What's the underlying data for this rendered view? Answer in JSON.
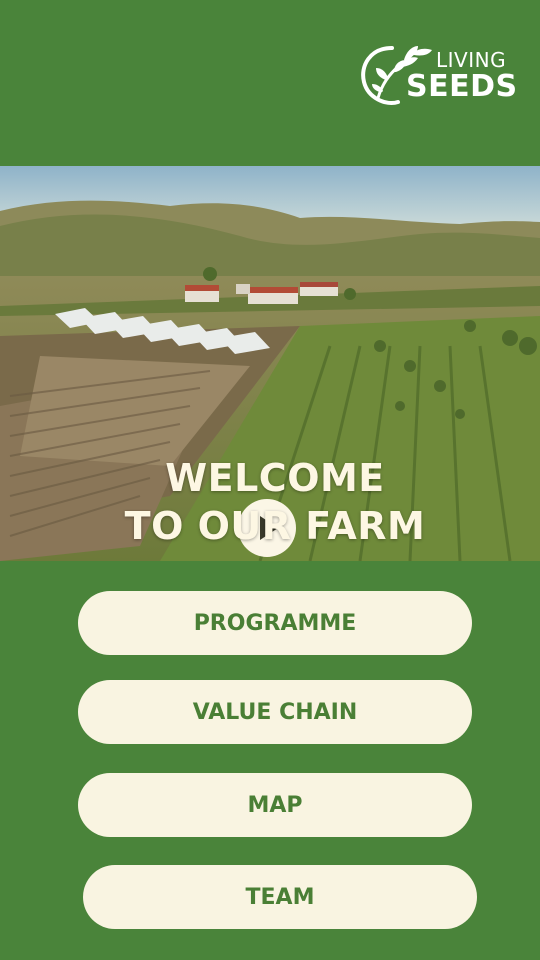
{
  "brand": {
    "line1": "LIVING",
    "line2": "SEEDS"
  },
  "hero": {
    "title_line1": "WELCOME",
    "title_line2": "TO OUR FARM",
    "play_icon": "play-icon"
  },
  "menu": [
    {
      "label": "PROGRAMME"
    },
    {
      "label": "VALUE CHAIN"
    },
    {
      "label": "MAP"
    },
    {
      "label": "TEAM"
    }
  ],
  "colors": {
    "background": "#4a843a",
    "button_bg": "#f9f4e1",
    "button_text": "#4a7f35",
    "title_text": "#fdf7e3"
  }
}
